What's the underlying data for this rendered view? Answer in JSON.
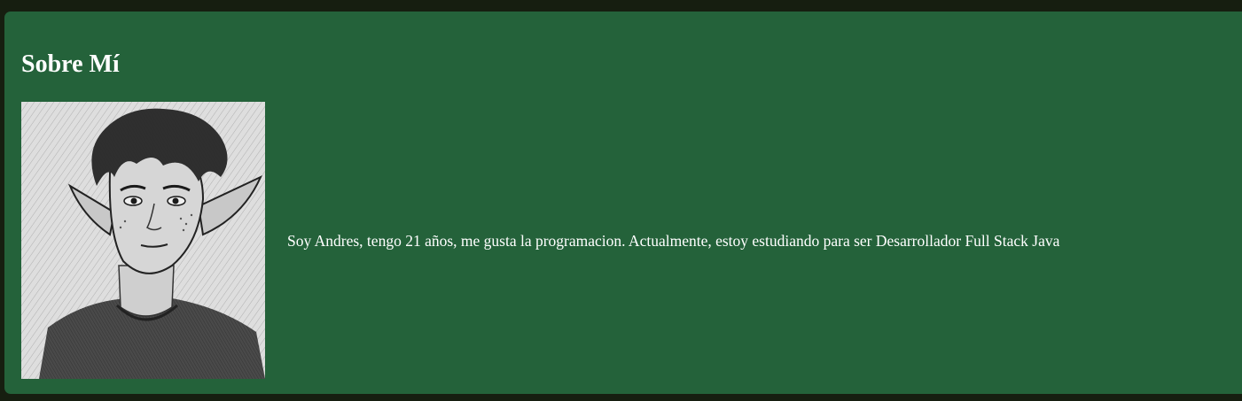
{
  "about": {
    "title": "Sobre Mí",
    "portrait_alt": "elf-boy-pencil-sketch",
    "bio": "Soy Andres, tengo 21 años, me gusta la programacion. Actualmente, estoy estudiando para ser Desarrollador Full Stack Java"
  },
  "colors": {
    "page_background": "#161e10",
    "card_background": "#24623a",
    "text": "#ffffff"
  }
}
